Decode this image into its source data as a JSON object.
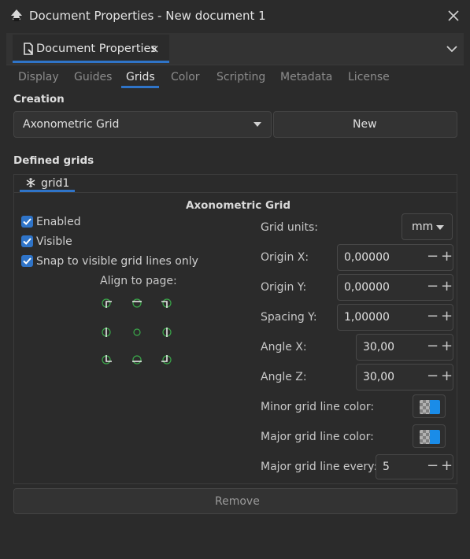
{
  "window": {
    "title": "Document Properties - New document 1"
  },
  "panel": {
    "tab_label": "Document Properties",
    "tab_close": "×"
  },
  "tabs": [
    "Display",
    "Guides",
    "Grids",
    "Color",
    "Scripting",
    "Metadata",
    "License"
  ],
  "active_tab": "Grids",
  "creation": {
    "title": "Creation",
    "grid_type": "Axonometric Grid",
    "new_label": "New"
  },
  "defined": {
    "title": "Defined grids",
    "grid_tab_label": "grid1",
    "grid_heading": "Axonometric Grid",
    "checkboxes": [
      {
        "label": "Enabled",
        "checked": true
      },
      {
        "label": "Visible",
        "checked": true
      },
      {
        "label": "Snap to visible grid lines only",
        "checked": true
      }
    ],
    "align_label": "Align to page:",
    "grid_units_label": "Grid units:",
    "grid_units_value": "mm",
    "origin_x_label": "Origin X:",
    "origin_x_value": "0,00000",
    "origin_y_label": "Origin Y:",
    "origin_y_value": "0,00000",
    "spacing_y_label": "Spacing Y:",
    "spacing_y_value": "1,00000",
    "angle_x_label": "Angle X:",
    "angle_x_value": "30,00",
    "angle_z_label": "Angle Z:",
    "angle_z_value": "30,00",
    "minor_color_label": "Minor grid line color:",
    "major_color_label": "Major grid line color:",
    "major_every_label": "Major grid line every:",
    "major_every_value": "5",
    "minor_color": "#1a8ce8",
    "major_color": "#1a8ce8",
    "remove_label": "Remove"
  },
  "stepper": {
    "minus": "−",
    "plus": "+"
  },
  "colors": {
    "accent": "#2f74c8",
    "anchor_green": "#3aa84a"
  }
}
